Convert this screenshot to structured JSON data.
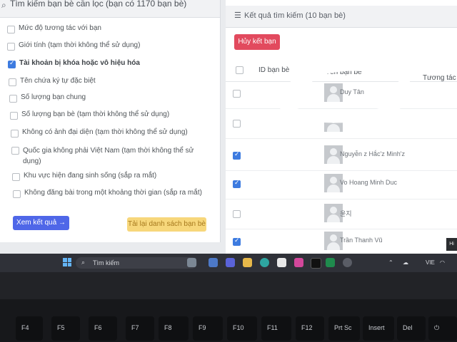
{
  "left_panel": {
    "header_title": "Tìm kiếm bạn bè cần lọc (bạn có 1170 bạn bè)",
    "filters": [
      {
        "label": "Mức độ tương tác với bạn",
        "checked": false
      },
      {
        "label": "Giới tính (tạm thời không thể sử dụng)",
        "checked": false
      },
      {
        "label": "Tài khoản bị khóa hoặc vô hiệu hóa",
        "checked": true
      },
      {
        "label": "Tên chứa ký tự đặc biệt",
        "checked": false
      },
      {
        "label": "Số lượng bạn chung",
        "checked": false
      },
      {
        "label": "Số lượng bạn bè (tạm thời không thể sử dụng)",
        "checked": false
      },
      {
        "label": "Không có ảnh đại diện (tạm thời không thể sử dụng)",
        "checked": false
      },
      {
        "label": "Quốc gia không phải Việt Nam (tạm thời không thể sử dụng)",
        "checked": false
      },
      {
        "label": "Khu vực hiện đang sinh sống (sắp ra mắt)",
        "checked": false
      },
      {
        "label": "Không đăng bài trong một khoảng thời gian (sắp ra mắt)",
        "checked": false
      }
    ],
    "view_results_label": "Xem kết quả →",
    "reload_label": "Tải lại danh sách bạn bè"
  },
  "right_panel": {
    "header_title": "Kết quả tìm kiếm (10 bạn bè)",
    "cancel_label": "Hủy kết bạn",
    "columns": {
      "id": "ID bạn bè",
      "name": "Tên bạn bè",
      "level": "Tương tác vớ"
    },
    "rows": [
      {
        "name": "Duy Tân",
        "checked": false
      },
      {
        "name": "",
        "checked": false
      },
      {
        "name": "Nguyễn z Hắc'z Minh'z",
        "checked": true
      },
      {
        "name": "Vo Hoang Minh Duc",
        "checked": true
      },
      {
        "name": "윤지",
        "checked": false
      },
      {
        "name": "Trần Thanh Vũ",
        "checked": true
      }
    ],
    "hint_label": "Hi"
  },
  "taskbar": {
    "search_label": "Tìm kiếm",
    "lang": "VIE"
  },
  "keyboard": {
    "keys": [
      "F4",
      "F5",
      "F6",
      "F7",
      "F8",
      "F9",
      "F10",
      "F11",
      "F12",
      "Prt Sc",
      "Insert",
      "Del"
    ]
  }
}
